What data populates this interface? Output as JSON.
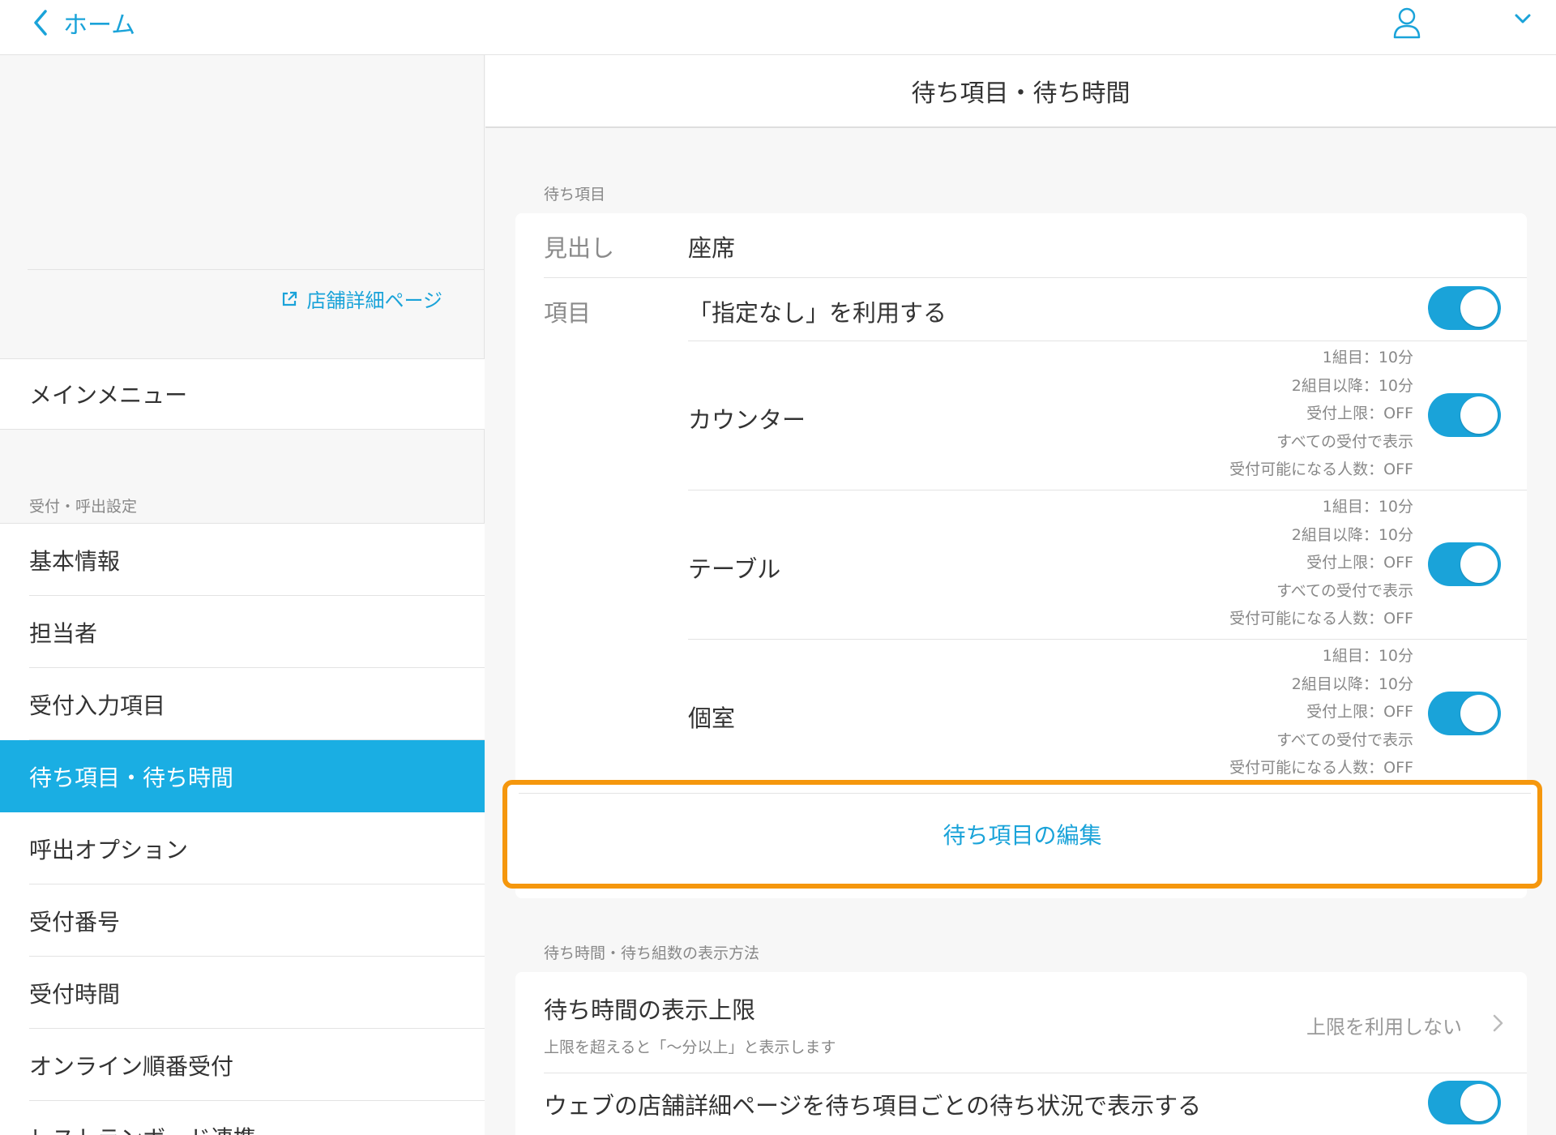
{
  "topbar": {
    "back_label": "ホーム"
  },
  "sidebar": {
    "store_link": "店舗詳細ページ",
    "main_menu": "メインメニュー",
    "section_title": "受付・呼出設定",
    "items": [
      {
        "label": "基本情報"
      },
      {
        "label": "担当者"
      },
      {
        "label": "受付入力項目"
      },
      {
        "label": "待ち項目・待ち時間"
      },
      {
        "label": "呼出オプション"
      },
      {
        "label": "受付番号"
      },
      {
        "label": "受付時間"
      },
      {
        "label": "オンライン順番受付"
      },
      {
        "label": "レストランボード連携"
      }
    ],
    "active_index": 3
  },
  "main": {
    "title": "待ち項目・待ち時間",
    "wait_items": {
      "section_label": "待ち項目",
      "heading_label": "見出し",
      "heading_value": "座席",
      "items_label": "項目",
      "unspecified_label": "「指定なし」を利用する",
      "unspecified_on": true,
      "entries": [
        {
          "name": "カウンター",
          "on": true,
          "details": [
            "1組目：10分",
            "2組目以降：10分",
            "受付上限：OFF",
            "すべての受付で表示",
            "受付可能になる人数：OFF"
          ]
        },
        {
          "name": "テーブル",
          "on": true,
          "details": [
            "1組目：10分",
            "2組目以降：10分",
            "受付上限：OFF",
            "すべての受付で表示",
            "受付可能になる人数：OFF"
          ]
        },
        {
          "name": "個室",
          "on": true,
          "details": [
            "1組目：10分",
            "2組目以降：10分",
            "受付上限：OFF",
            "すべての受付で表示",
            "受付可能になる人数：OFF"
          ]
        }
      ],
      "edit_button": "待ち項目の編集"
    },
    "display": {
      "section_label": "待ち時間・待ち組数の表示方法",
      "limit_title": "待ち時間の表示上限",
      "limit_sub": "上限を超えると「〜分以上」と表示します",
      "limit_value": "上限を利用しない",
      "web_label": "ウェブの店舗詳細ページを待ち項目ごとの待ち状況で表示する",
      "web_on": true
    }
  },
  "colors": {
    "accent": "#1aa3d9",
    "active_bg": "#1aaee3",
    "highlight": "#f5970d"
  }
}
